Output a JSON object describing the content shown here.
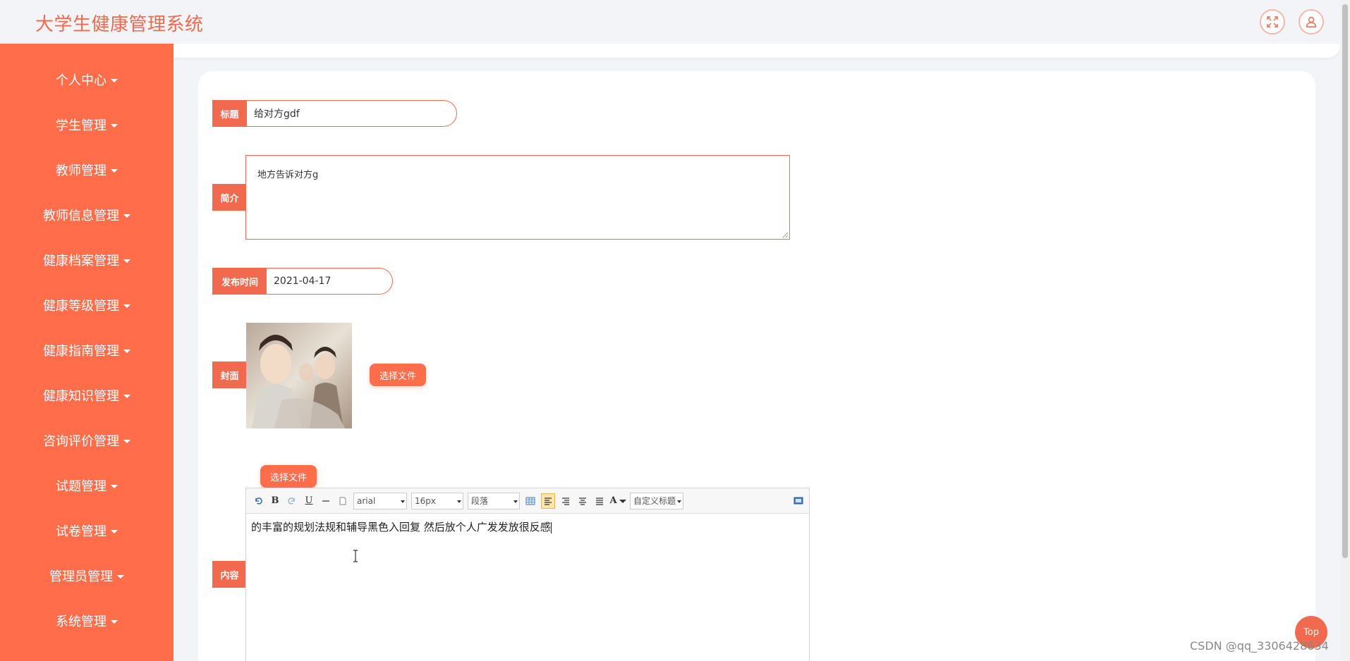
{
  "header": {
    "title": "大学生健康管理系统",
    "fullscreen_icon": "expand-icon",
    "user_icon": "user-icon"
  },
  "sidebar": {
    "items": [
      {
        "label": "个人中心"
      },
      {
        "label": "学生管理"
      },
      {
        "label": "教师管理"
      },
      {
        "label": "教师信息管理"
      },
      {
        "label": "健康档案管理"
      },
      {
        "label": "健康等级管理"
      },
      {
        "label": "健康指南管理"
      },
      {
        "label": "健康知识管理"
      },
      {
        "label": "咨询评价管理"
      },
      {
        "label": "试题管理"
      },
      {
        "label": "试卷管理"
      },
      {
        "label": "管理员管理"
      },
      {
        "label": "系统管理"
      }
    ]
  },
  "form": {
    "title_label": "标题",
    "title_value": "给对方gdf",
    "intro_label": "简介",
    "intro_value": "地方告诉对方g",
    "publish_label": "发布时间",
    "publish_value": "2021-04-17",
    "cover_label": "封面",
    "cover_pick_label": "选择文件",
    "content_pick_label": "选择文件",
    "content_label": "内容",
    "content_value": "的丰富的规划法规和辅导黑色入回复 然后放个人广发发放很反感"
  },
  "editor_toolbar": {
    "font_family": "arial",
    "font_size": "16px",
    "paragraph": "段落",
    "custom_title": "自定义标题",
    "bold": "B",
    "underline": "U",
    "font_color": "A"
  },
  "misc": {
    "top_button": "Top",
    "watermark": "CSDN @qq_3306428634"
  },
  "colors": {
    "accent": "#f1694e",
    "sidebar_bg": "#ff6d4a",
    "page_bg": "#f2f4f7"
  }
}
